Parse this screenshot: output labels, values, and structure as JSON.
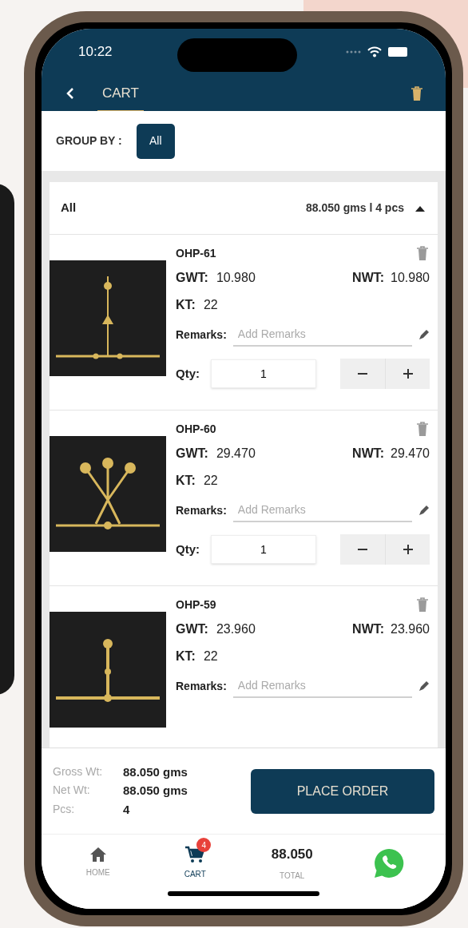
{
  "status_bar": {
    "time": "10:22"
  },
  "header": {
    "title": "CART"
  },
  "group_by": {
    "label": "GROUP BY :",
    "options": [
      {
        "label": "All",
        "selected": true
      }
    ]
  },
  "group": {
    "name": "All",
    "summary": "88.050 gms l 4 pcs",
    "expanded": true
  },
  "items": [
    {
      "code": "OHP-61",
      "gwt_label": "GWT:",
      "gwt": "10.980",
      "nwt_label": "NWT:",
      "nwt": "10.980",
      "kt_label": "KT:",
      "kt": "22",
      "remarks_label": "Remarks:",
      "remarks_placeholder": "Add Remarks",
      "qty_label": "Qty:",
      "qty": "1"
    },
    {
      "code": "OHP-60",
      "gwt_label": "GWT:",
      "gwt": "29.470",
      "nwt_label": "NWT:",
      "nwt": "29.470",
      "kt_label": "KT:",
      "kt": "22",
      "remarks_label": "Remarks:",
      "remarks_placeholder": "Add Remarks",
      "qty_label": "Qty:",
      "qty": "1"
    },
    {
      "code": "OHP-59",
      "gwt_label": "GWT:",
      "gwt": "23.960",
      "nwt_label": "NWT:",
      "nwt": "23.960",
      "kt_label": "KT:",
      "kt": "22",
      "remarks_label": "Remarks:",
      "remarks_placeholder": "Add Remarks"
    }
  ],
  "totals": [
    {
      "label": "Gross Wt:",
      "value": "88.050 gms"
    },
    {
      "label": "Net Wt:",
      "value": "88.050 gms"
    },
    {
      "label": "Pcs:",
      "value": "4"
    }
  ],
  "place_order": "PLACE ORDER",
  "nav": [
    {
      "kind": "home",
      "label": "HOME",
      "selected": false
    },
    {
      "kind": "cart",
      "label": "CART",
      "badge": "4",
      "selected": true
    },
    {
      "kind": "total",
      "value": "88.050",
      "label": "TOTAL",
      "selected": false
    },
    {
      "kind": "whatsapp",
      "selected": false
    }
  ]
}
